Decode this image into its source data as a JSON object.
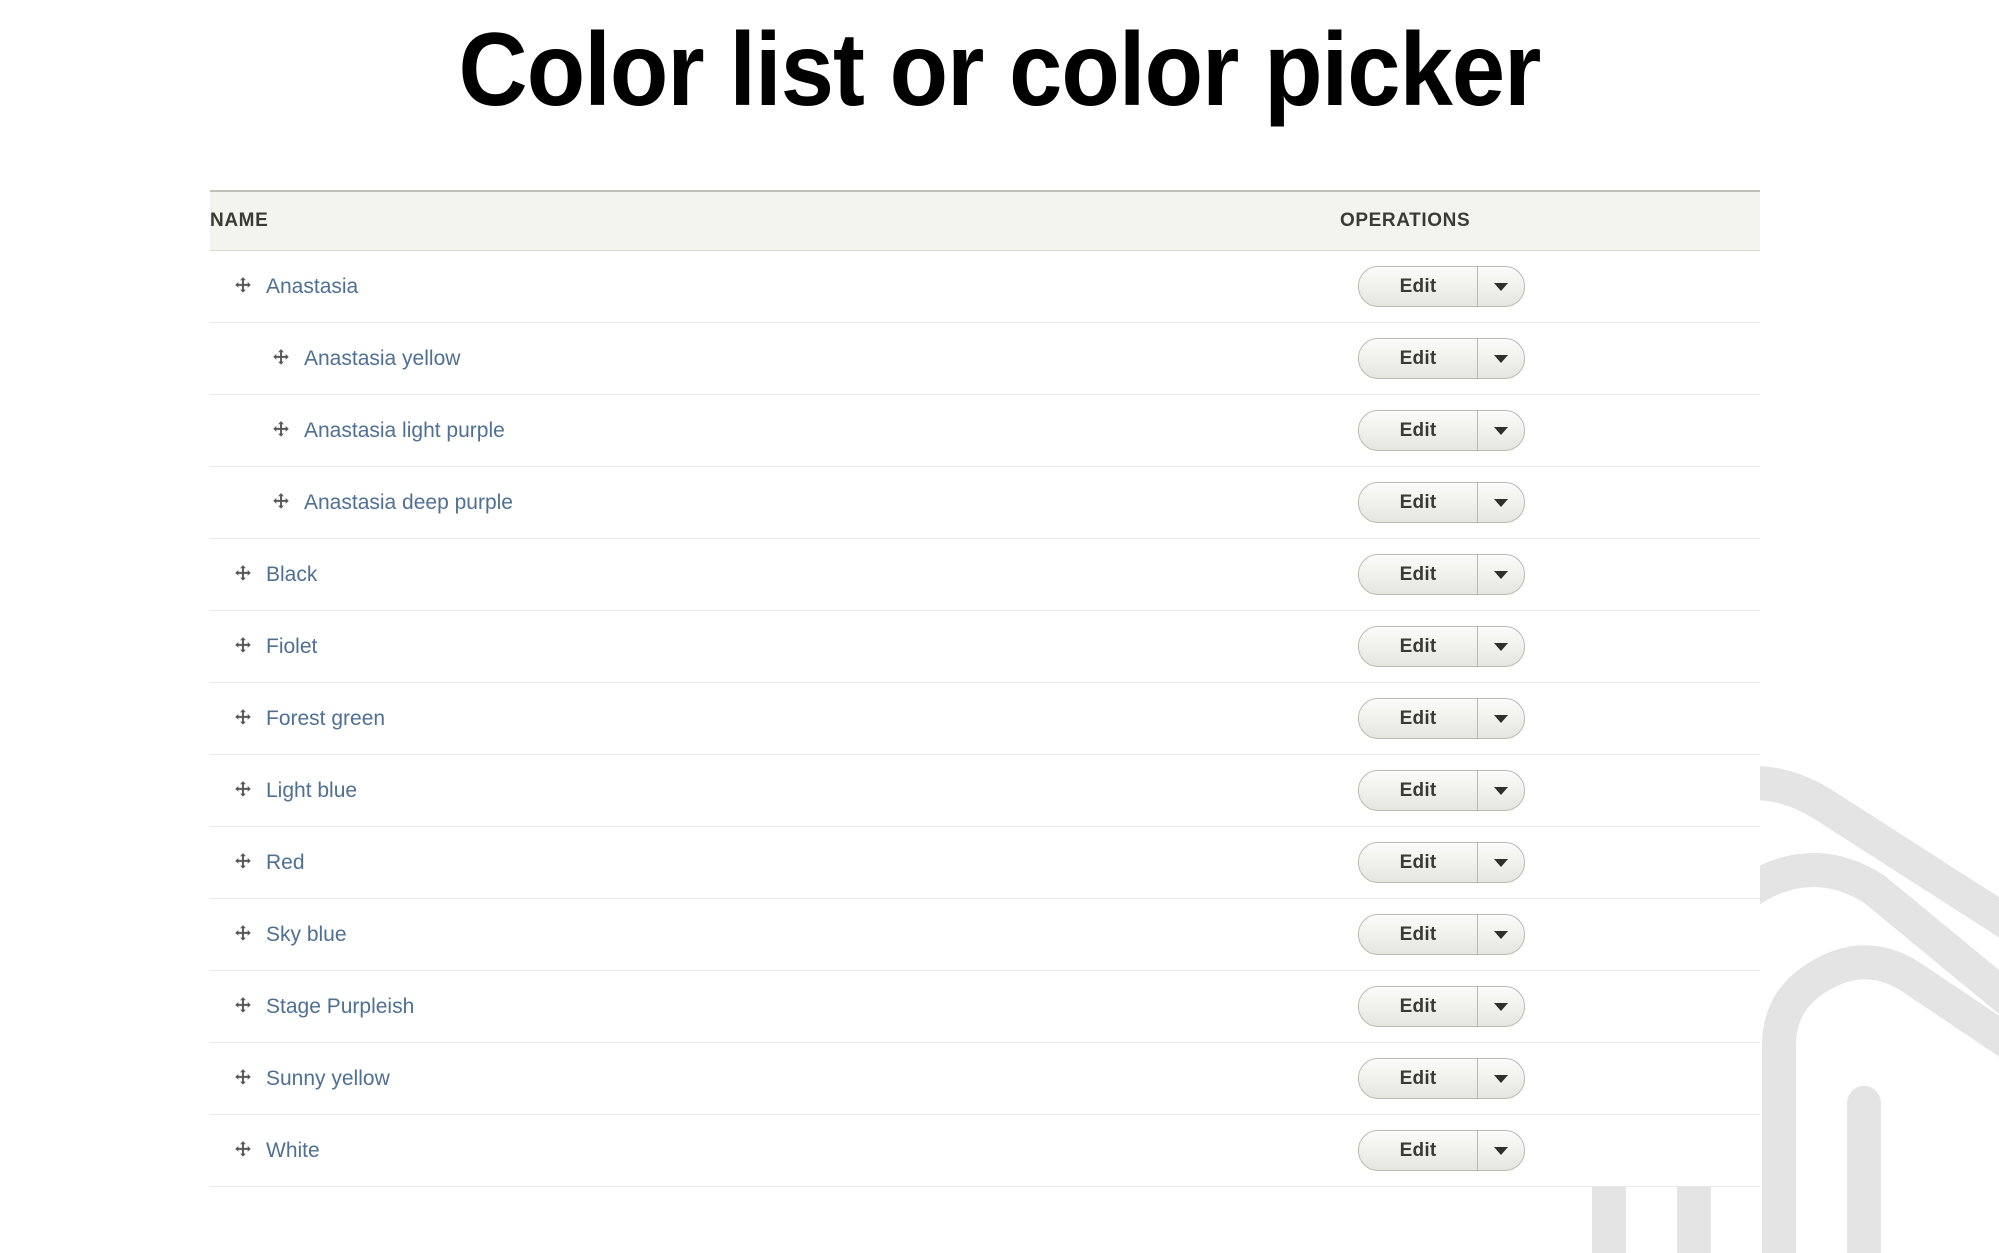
{
  "page": {
    "title": "Color list or color picker",
    "background_color": "#ffffff",
    "link_color": "#4f7093",
    "header_background": "#f4f4ef",
    "watermark_color": "#e4e4e4"
  },
  "table": {
    "columns": [
      {
        "key": "name",
        "label": "NAME"
      },
      {
        "key": "operations",
        "label": "OPERATIONS"
      }
    ],
    "rows": [
      {
        "name": "Anastasia",
        "depth": 0,
        "drag_icon": "move-cross-icon",
        "edit_label": "Edit",
        "caret_icon": "chevron-down-icon"
      },
      {
        "name": "Anastasia yellow",
        "depth": 1,
        "drag_icon": "move-cross-icon",
        "edit_label": "Edit",
        "caret_icon": "chevron-down-icon"
      },
      {
        "name": "Anastasia light purple",
        "depth": 1,
        "drag_icon": "move-cross-icon",
        "edit_label": "Edit",
        "caret_icon": "chevron-down-icon"
      },
      {
        "name": "Anastasia deep purple",
        "depth": 1,
        "drag_icon": "move-cross-icon",
        "edit_label": "Edit",
        "caret_icon": "chevron-down-icon"
      },
      {
        "name": "Black",
        "depth": 0,
        "drag_icon": "move-cross-icon",
        "edit_label": "Edit",
        "caret_icon": "chevron-down-icon"
      },
      {
        "name": "Fiolet",
        "depth": 0,
        "drag_icon": "move-cross-icon",
        "edit_label": "Edit",
        "caret_icon": "chevron-down-icon"
      },
      {
        "name": "Forest green",
        "depth": 0,
        "drag_icon": "move-cross-icon",
        "edit_label": "Edit",
        "caret_icon": "chevron-down-icon"
      },
      {
        "name": "Light blue",
        "depth": 0,
        "drag_icon": "move-cross-icon",
        "edit_label": "Edit",
        "caret_icon": "chevron-down-icon"
      },
      {
        "name": "Red",
        "depth": 0,
        "drag_icon": "move-cross-icon",
        "edit_label": "Edit",
        "caret_icon": "chevron-down-icon"
      },
      {
        "name": "Sky blue",
        "depth": 0,
        "drag_icon": "move-cross-icon",
        "edit_label": "Edit",
        "caret_icon": "chevron-down-icon"
      },
      {
        "name": "Stage Purpleish",
        "depth": 0,
        "drag_icon": "move-cross-icon",
        "edit_label": "Edit",
        "caret_icon": "chevron-down-icon"
      },
      {
        "name": "Sunny yellow",
        "depth": 0,
        "drag_icon": "move-cross-icon",
        "edit_label": "Edit",
        "caret_icon": "chevron-down-icon"
      },
      {
        "name": "White",
        "depth": 0,
        "drag_icon": "move-cross-icon",
        "edit_label": "Edit",
        "caret_icon": "chevron-down-icon"
      }
    ]
  }
}
